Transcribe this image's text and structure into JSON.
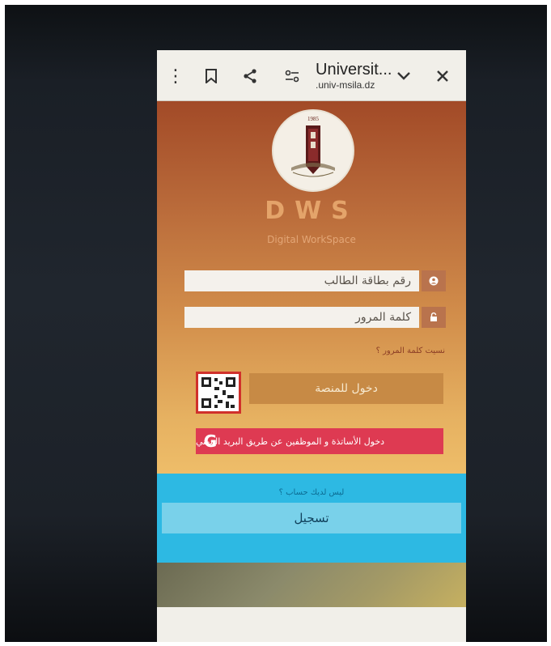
{
  "browser": {
    "title": "Universit...",
    "url": ".univ-msila.dz",
    "icons": [
      "more-vert-icon",
      "bookmark-icon",
      "share-icon",
      "site-settings-icon",
      "chevron-down-icon",
      "close-icon"
    ]
  },
  "logo": {
    "year": "1985"
  },
  "app": {
    "name": "DWS",
    "subtitle": "Digital WorkSpace"
  },
  "form": {
    "student_id_placeholder": "رقم بطاقة الطالب",
    "password_placeholder": "كلمة المرور",
    "forgot_password": "نسيت كلمة المرور ؟",
    "login_label": "دخول للمنصة",
    "google_login_label": "دخول الأساتذة و الموظفين عن طريق البريد المهني"
  },
  "register": {
    "question": "ليس لديك حساب ؟",
    "button_label": "تسجيل"
  },
  "colors": {
    "gradient_top": "#a24a27",
    "gradient_bottom": "#eebd69",
    "login_button": "#c78a45",
    "google_button": "#de3a52",
    "register_band": "#2db9e3"
  }
}
